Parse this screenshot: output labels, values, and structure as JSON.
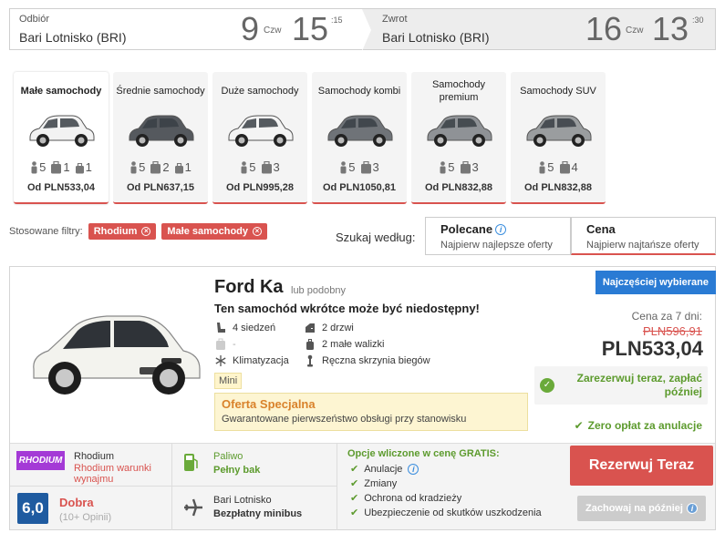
{
  "pickup": {
    "label": "Odbiór",
    "location": "Bari Lotnisko (BRI)",
    "day": "9",
    "dow": "Czw",
    "hour": "15",
    "min": ":15"
  },
  "return": {
    "label": "Zwrot",
    "location": "Bari Lotnisko (BRI)",
    "day": "16",
    "dow": "Czw",
    "hour": "13",
    "min": ":30"
  },
  "categories": [
    {
      "name": "Małe samochody",
      "pax": "5",
      "bags_big": "1",
      "bags_small": "1",
      "price": "Od PLN533,04",
      "color": "#f2f2f2"
    },
    {
      "name": "Średnie samochody",
      "pax": "5",
      "bags_big": "2",
      "bags_small": "1",
      "price": "Od PLN637,15",
      "color": "#55595e"
    },
    {
      "name": "Duże samochody",
      "pax": "5",
      "bags_big": "3",
      "bags_small": "",
      "price": "Od PLN995,28",
      "color": "#f4f4f4"
    },
    {
      "name": "Samochody kombi",
      "pax": "5",
      "bags_big": "3",
      "bags_small": "",
      "price": "Od PLN1050,81",
      "color": "#6f7378"
    },
    {
      "name": "Samochody premium",
      "pax": "5",
      "bags_big": "3",
      "bags_small": "",
      "price": "Od PLN832,88",
      "color": "#8f9296"
    },
    {
      "name": "Samochody SUV",
      "pax": "5",
      "bags_big": "4",
      "bags_small": "",
      "price": "Od PLN832,88",
      "color": "#9a9d9f"
    }
  ],
  "filters": {
    "label": "Stosowane filtry:",
    "chips": [
      "Rhodium",
      "Małe samochody"
    ]
  },
  "sort": {
    "label": "Szukaj według:",
    "recommended": {
      "title": "Polecane",
      "sub": "Najpierw najlepsze oferty"
    },
    "price": {
      "title": "Cena",
      "sub": "Najpierw najtańsze oferty"
    }
  },
  "car": {
    "name": "Ford Ka",
    "similar": "lub podobny",
    "warning": "Ten samochód wkrótce może być niedostępny!",
    "seats": "4 siedzeń",
    "doors": "2 drzwi",
    "bags_big": "-",
    "bags_small": "2 małe walizki",
    "ac": "Klimatyzacja",
    "gearbox": "Ręczna skrzynia biegów",
    "class": "Mini",
    "offer_title": "Oferta Specjalna",
    "offer_desc": "Gwarantowane pierwszeństwo obsługi przy stanowisku",
    "badge": "Najczęściej wybierane",
    "price_label": "Cena za 7 dni:",
    "price_old": "PLN596,91",
    "price_new": "PLN533,04",
    "pay_later": "Zarezerwuj teraz, zapłać później",
    "no_fee": "Zero opłat za anulacje"
  },
  "supplier": {
    "logo": "RHODIUM",
    "name": "Rhodium",
    "terms": "Rhodium warunki wynajmu",
    "score": "6,0",
    "rating": "Dobra",
    "opinions": "(10+ Opinii)",
    "fuel_label": "Paliwo",
    "fuel_value": "Pełny bak",
    "loc_name": "Bari Lotnisko",
    "loc_value": "Bezpłatny minibus"
  },
  "included": {
    "title": "Opcje wliczone w cenę GRATIS:",
    "items": [
      "Anulacje",
      "Zmiany",
      "Ochrona od kradzieży",
      "Ubezpieczenie od skutków uszkodzenia"
    ]
  },
  "actions": {
    "book": "Rezerwuj Teraz",
    "save": "Zachowaj na później"
  }
}
